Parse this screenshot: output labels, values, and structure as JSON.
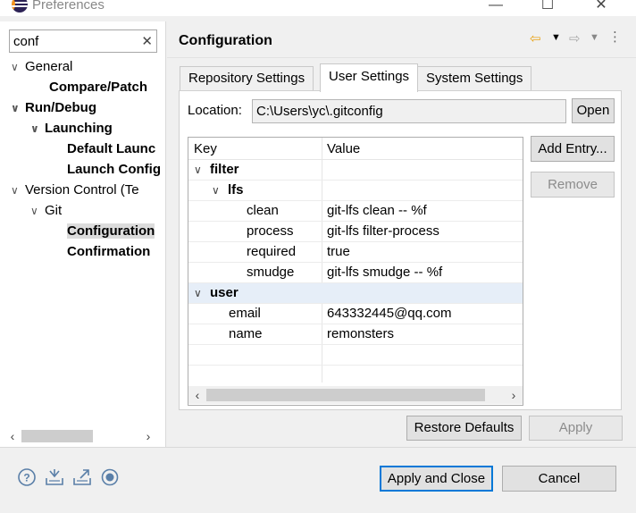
{
  "window": {
    "title": "Preferences",
    "controls": {
      "minimize": "—",
      "maximize": "☐",
      "close": "✕"
    }
  },
  "sidebar": {
    "filter_value": "conf",
    "filter_clear": "✕",
    "tree": [
      {
        "label": "General",
        "expanded": true,
        "bold": false
      },
      {
        "label": "Compare/Patch",
        "bold": true
      },
      {
        "label": "Run/Debug",
        "expanded": true,
        "bold": true
      },
      {
        "label": "Launching",
        "expanded": true,
        "bold": true
      },
      {
        "label": "Default Launc",
        "bold": true
      },
      {
        "label": "Launch Config",
        "bold": true
      },
      {
        "label": "Version Control (Te",
        "expanded": true,
        "bold": false
      },
      {
        "label": "Git",
        "expanded": true,
        "bold": false
      },
      {
        "label": "Configuration",
        "bold": true,
        "selected": true
      },
      {
        "label": "Confirmation",
        "bold": true
      }
    ]
  },
  "main": {
    "title": "Configuration",
    "tabs": [
      {
        "label": "Repository Settings",
        "active": false
      },
      {
        "label": "User Settings",
        "active": true
      },
      {
        "label": "System Settings",
        "active": false
      }
    ],
    "location_label": "Location:",
    "location_value": "C:\\Users\\yc\\.gitconfig",
    "open_button": "Open",
    "add_entry_button": "Add Entry...",
    "remove_button": "Remove",
    "table": {
      "columns": [
        "Key",
        "Value"
      ],
      "rows": [
        {
          "key": "filter",
          "value": "",
          "bold": true,
          "twisty": "∨"
        },
        {
          "key": "lfs",
          "value": "",
          "bold": true,
          "twisty": "∨"
        },
        {
          "key": "clean",
          "value": "git-lfs clean -- %f"
        },
        {
          "key": "process",
          "value": "git-lfs filter-process"
        },
        {
          "key": "required",
          "value": "true"
        },
        {
          "key": "smudge",
          "value": "git-lfs smudge -- %f"
        },
        {
          "key": "user",
          "value": "",
          "bold": true,
          "twisty": "∨"
        },
        {
          "key": "email",
          "value": "643332445@qq.com"
        },
        {
          "key": "name",
          "value": "remonsters"
        }
      ]
    },
    "restore_defaults_button": "Restore Defaults",
    "apply_button": "Apply"
  },
  "footer": {
    "apply_close_button": "Apply and Close",
    "cancel_button": "Cancel"
  }
}
